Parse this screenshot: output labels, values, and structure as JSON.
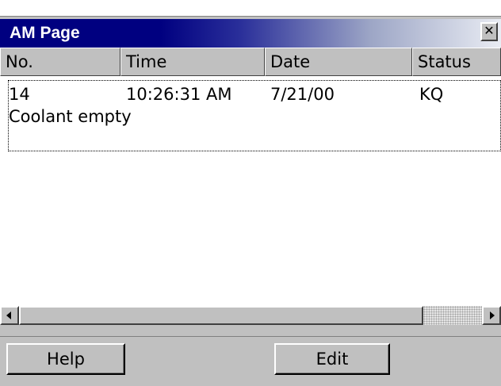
{
  "window": {
    "title": "AM Page",
    "close_glyph": "✕"
  },
  "columns": [
    {
      "label": "No."
    },
    {
      "label": "Time"
    },
    {
      "label": "Date"
    },
    {
      "label": "Status"
    }
  ],
  "rows": [
    {
      "no": "14",
      "time": "10:26:31 AM",
      "date": "7/21/00",
      "status": "KQ",
      "message": "Coolant empty"
    }
  ],
  "buttons": {
    "help": "Help",
    "edit": "Edit"
  },
  "icons": {
    "close": "close-icon",
    "scroll_left": "scroll-left-arrow-icon",
    "scroll_right": "scroll-right-arrow-icon"
  }
}
